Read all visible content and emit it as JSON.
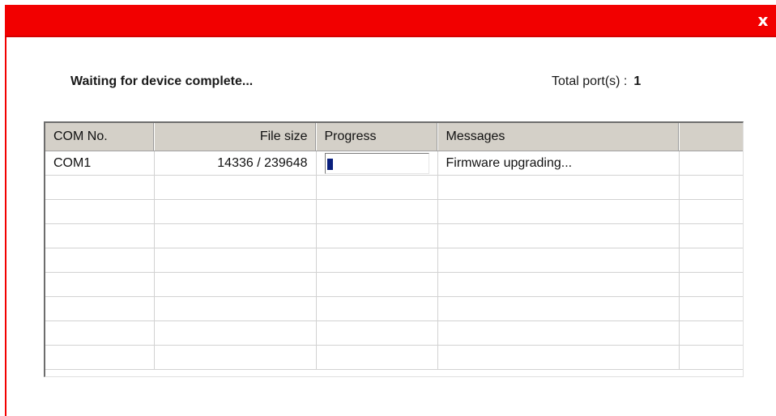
{
  "window": {
    "close_glyph": "x",
    "accent_color": "#f20000"
  },
  "status": {
    "text": "Waiting for device complete...",
    "total_ports_label": "Total port(s) :",
    "total_ports_value": "1"
  },
  "table": {
    "columns": [
      "COM No.",
      "File size",
      "Progress",
      "Messages",
      ""
    ],
    "rows": [
      {
        "com": "COM1",
        "file_size": "14336 / 239648",
        "progress": 0.06,
        "message": "Firmware upgrading..."
      }
    ],
    "progress_color": "#0a1f7d"
  }
}
